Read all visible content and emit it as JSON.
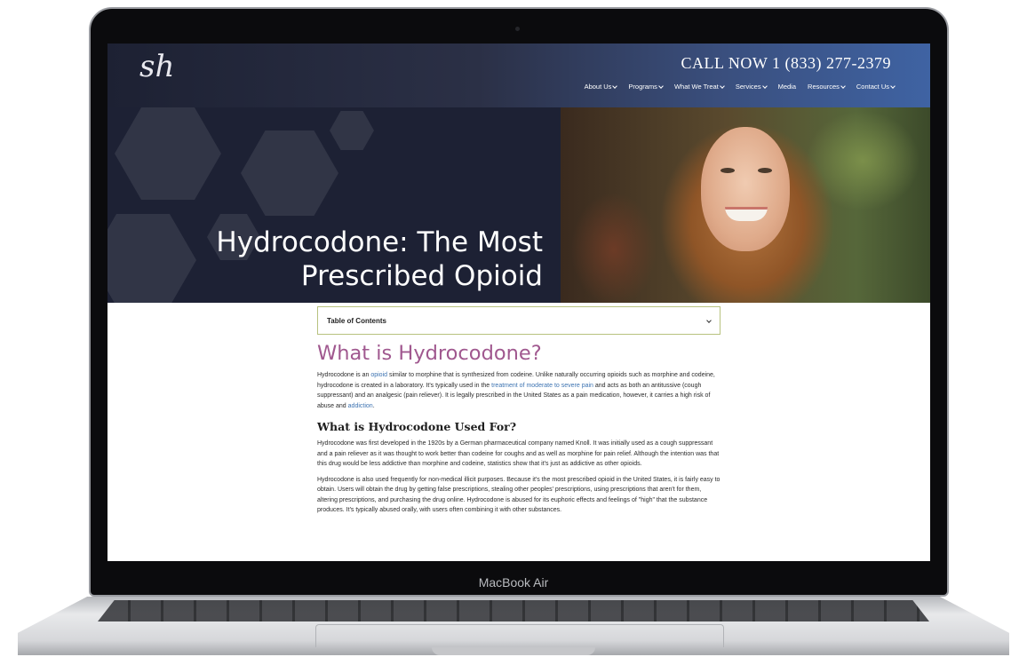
{
  "device": {
    "label": "MacBook Air"
  },
  "site": {
    "logo_text": "sh",
    "call_now": "CALL NOW 1 (833) 277-2379",
    "nav": [
      {
        "label": "About Us"
      },
      {
        "label": "Programs"
      },
      {
        "label": "What We Treat"
      },
      {
        "label": "Services"
      },
      {
        "label": "Media"
      },
      {
        "label": "Resources"
      },
      {
        "label": "Contact Us"
      }
    ],
    "hero": {
      "line1": "Hydrocodone: The Most",
      "line2": "Prescribed Opioid"
    },
    "toc_label": "Table of Contents",
    "h1": "What is Hydrocodone?",
    "p1": {
      "a": "Hydrocodone is an ",
      "link1": "opioid",
      "b": " similar to morphine that is synthesized from codeine. Unlike naturally occurring opioids such as morphine and codeine, hydrocodone is created in a laboratory. It's typically used in the ",
      "link2": "treatment of moderate to severe pain",
      "c": " and acts as both an antitussive (cough suppressant) and an analgesic (pain reliever). It is legally prescribed in the United States as a pain medication, however, it carries a high risk of abuse and ",
      "link3": "addiction",
      "d": "."
    },
    "h2": "What is Hydrocodone Used For?",
    "p2": "Hydrocodone was first developed in the 1920s by a German pharmaceutical company named Knoll. It was initially used as a cough suppressant and a pain reliever as it was thought to work better than codeine for coughs and as well as morphine for pain relief. Although the intention was that this drug would be less addictive than morphine and codeine, statistics show that it's just as addictive as other opioids.",
    "p3": "Hydrocodone is also used frequently for non-medical illicit purposes. Because it's the most prescribed opioid in the United States, it is fairly easy to obtain. Users will obtain the drug by getting false prescriptions, stealing other peoples' prescriptions, using prescriptions that aren't for them, altering prescriptions, and purchasing the drug online. Hydrocodone is abused for its euphoric effects and feelings of \"high\" that the substance produces. It's typically abused orally, with users often combining it with other substances."
  }
}
